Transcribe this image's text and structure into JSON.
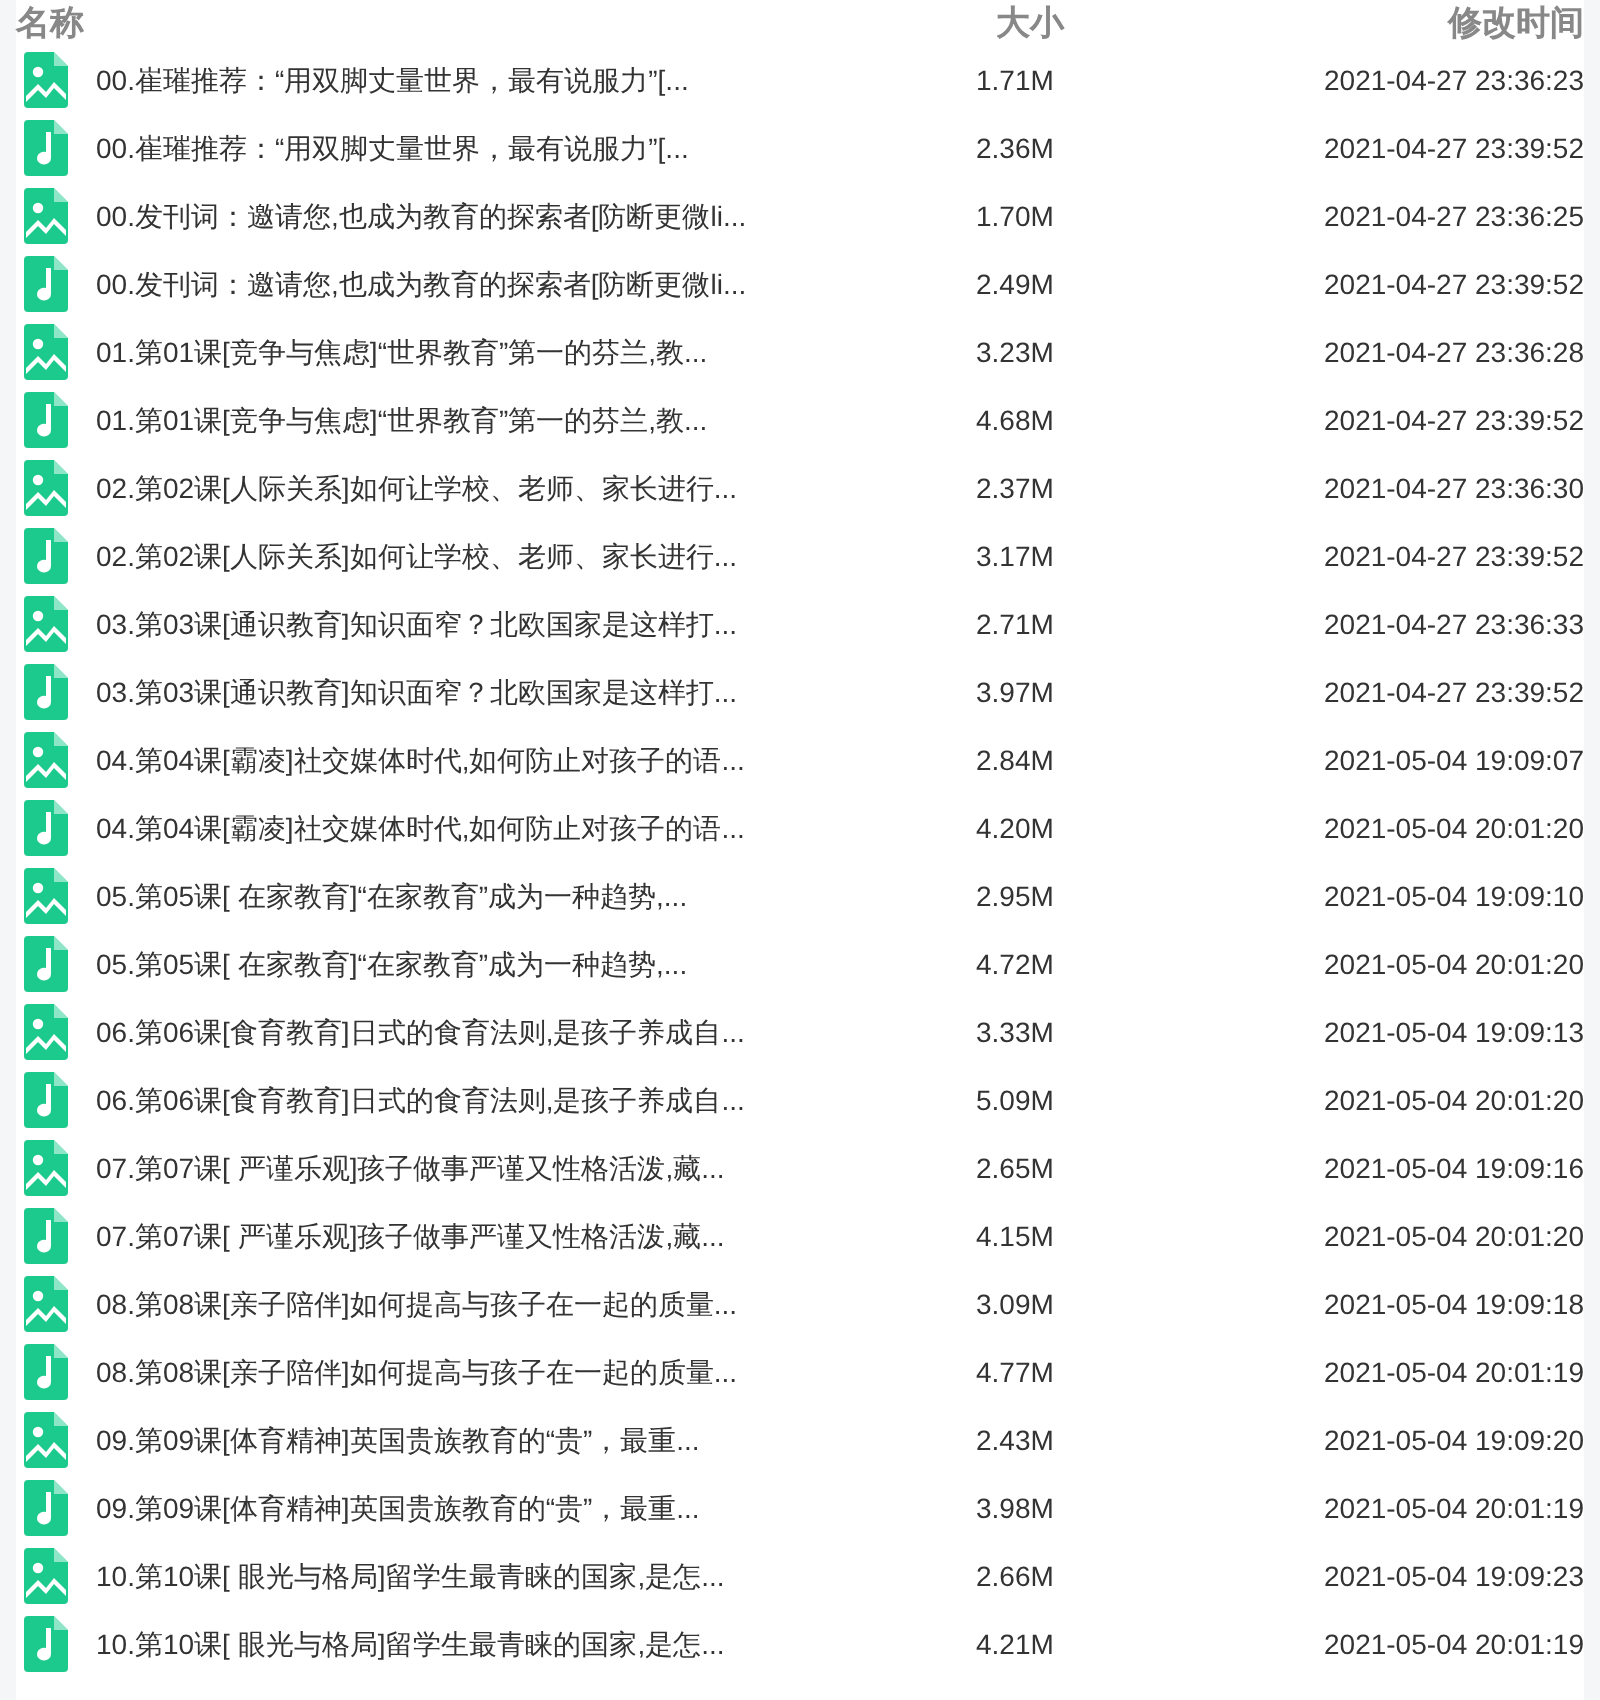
{
  "columns": [
    {
      "label": "名称"
    },
    {
      "label": "大小"
    },
    {
      "label": "修改时间"
    }
  ],
  "rows": [
    {
      "kind": "image",
      "name": "00.崔璀推荐：“用双脚丈量世界，最有说服力”[...",
      "size": "1.71M",
      "modified": "2021-04-27 23:36:23"
    },
    {
      "kind": "audio",
      "name": "00.崔璀推荐：“用双脚丈量世界，最有说服力”[...",
      "size": "2.36M",
      "modified": "2021-04-27 23:39:52"
    },
    {
      "kind": "image",
      "name": "00.发刊词：邀请您,也成为教育的探索者[防断更微li...",
      "size": "1.70M",
      "modified": "2021-04-27 23:36:25"
    },
    {
      "kind": "audio",
      "name": "00.发刊词：邀请您,也成为教育的探索者[防断更微li...",
      "size": "2.49M",
      "modified": "2021-04-27 23:39:52"
    },
    {
      "kind": "image",
      "name": "01.第01课[竞争与焦虑]“世界教育”第一的芬兰,教...",
      "size": "3.23M",
      "modified": "2021-04-27 23:36:28"
    },
    {
      "kind": "audio",
      "name": "01.第01课[竞争与焦虑]“世界教育”第一的芬兰,教...",
      "size": "4.68M",
      "modified": "2021-04-27 23:39:52"
    },
    {
      "kind": "image",
      "name": "02.第02课[人际关系]如何让学校、老师、家长进行...",
      "size": "2.37M",
      "modified": "2021-04-27 23:36:30"
    },
    {
      "kind": "audio",
      "name": "02.第02课[人际关系]如何让学校、老师、家长进行...",
      "size": "3.17M",
      "modified": "2021-04-27 23:39:52"
    },
    {
      "kind": "image",
      "name": "03.第03课[通识教育]知识面窄？北欧国家是这样打...",
      "size": "2.71M",
      "modified": "2021-04-27 23:36:33"
    },
    {
      "kind": "audio",
      "name": "03.第03课[通识教育]知识面窄？北欧国家是这样打...",
      "size": "3.97M",
      "modified": "2021-04-27 23:39:52"
    },
    {
      "kind": "image",
      "name": "04.第04课[霸凌]社交媒体时代,如何防止对孩子的语...",
      "size": "2.84M",
      "modified": "2021-05-04 19:09:07"
    },
    {
      "kind": "audio",
      "name": "04.第04课[霸凌]社交媒体时代,如何防止对孩子的语...",
      "size": "4.20M",
      "modified": "2021-05-04 20:01:20"
    },
    {
      "kind": "image",
      "name": "05.第05课[ 在家教育]“在家教育”成为一种趋势,...",
      "size": "2.95M",
      "modified": "2021-05-04 19:09:10"
    },
    {
      "kind": "audio",
      "name": "05.第05课[ 在家教育]“在家教育”成为一种趋势,...",
      "size": "4.72M",
      "modified": "2021-05-04 20:01:20"
    },
    {
      "kind": "image",
      "name": "06.第06课[食育教育]日式的食育法则,是孩子养成自...",
      "size": "3.33M",
      "modified": "2021-05-04 19:09:13"
    },
    {
      "kind": "audio",
      "name": "06.第06课[食育教育]日式的食育法则,是孩子养成自...",
      "size": "5.09M",
      "modified": "2021-05-04 20:01:20"
    },
    {
      "kind": "image",
      "name": "07.第07课[ 严谨乐观]孩子做事严谨又性格活泼,藏...",
      "size": "2.65M",
      "modified": "2021-05-04 19:09:16"
    },
    {
      "kind": "audio",
      "name": "07.第07课[ 严谨乐观]孩子做事严谨又性格活泼,藏...",
      "size": "4.15M",
      "modified": "2021-05-04 20:01:20"
    },
    {
      "kind": "image",
      "name": "08.第08课[亲子陪伴]如何提高与孩子在一起的质量...",
      "size": "3.09M",
      "modified": "2021-05-04 19:09:18"
    },
    {
      "kind": "audio",
      "name": "08.第08课[亲子陪伴]如何提高与孩子在一起的质量...",
      "size": "4.77M",
      "modified": "2021-05-04 20:01:19"
    },
    {
      "kind": "image",
      "name": "09.第09课[体育精神]英国贵族教育的“贵”，最重...",
      "size": "2.43M",
      "modified": "2021-05-04 19:09:20"
    },
    {
      "kind": "audio",
      "name": "09.第09课[体育精神]英国贵族教育的“贵”，最重...",
      "size": "3.98M",
      "modified": "2021-05-04 20:01:19"
    },
    {
      "kind": "image",
      "name": "10.第10课[ 眼光与格局]留学生最青睐的国家,是怎...",
      "size": "2.66M",
      "modified": "2021-05-04 19:09:23"
    },
    {
      "kind": "audio",
      "name": "10.第10课[ 眼光与格局]留学生最青睐的国家,是怎...",
      "size": "4.21M",
      "modified": "2021-05-04 20:01:19"
    }
  ]
}
